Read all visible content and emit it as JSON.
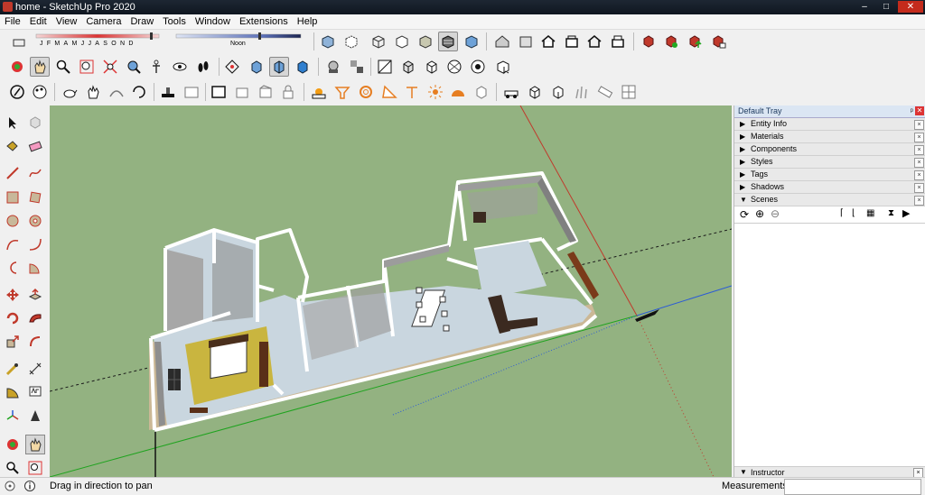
{
  "window": {
    "title": "home - SketchUp Pro 2020",
    "min": "–",
    "max": "□",
    "close": "✕"
  },
  "menu": [
    {
      "label": "File"
    },
    {
      "label": "Edit"
    },
    {
      "label": "View"
    },
    {
      "label": "Camera"
    },
    {
      "label": "Draw"
    },
    {
      "label": "Tools"
    },
    {
      "label": "Window"
    },
    {
      "label": "Extensions"
    },
    {
      "label": "Help"
    }
  ],
  "shadows": {
    "months": [
      "J",
      "F",
      "M",
      "A",
      "M",
      "J",
      "J",
      "A",
      "S",
      "O",
      "N",
      "D"
    ],
    "time_label": "Noon"
  },
  "tray": {
    "title": "Default Tray",
    "pin": "ᵖ",
    "panels": [
      {
        "label": "Entity Info",
        "expanded": false
      },
      {
        "label": "Materials",
        "expanded": false
      },
      {
        "label": "Components",
        "expanded": false
      },
      {
        "label": "Styles",
        "expanded": false
      },
      {
        "label": "Tags",
        "expanded": false
      },
      {
        "label": "Shadows",
        "expanded": false
      },
      {
        "label": "Scenes",
        "expanded": true
      }
    ],
    "bottom_panel": {
      "label": "Instructor"
    }
  },
  "status": {
    "message": "Drag in direction to pan",
    "measurements_label": "Measurements",
    "measurements_value": ""
  },
  "colors": {
    "viewport_bg": "#93b281",
    "wall_top": "#ffffff",
    "wall_side": "#a7a7a7",
    "floor": "#c9d6df",
    "bedroom_floor": "#c9b53f",
    "axis_red": "#c0392b",
    "axis_green": "#1fa31f",
    "axis_blue": "#2b5bd6",
    "titlebar": "#162030",
    "tray_header": "#dbe6f3"
  }
}
